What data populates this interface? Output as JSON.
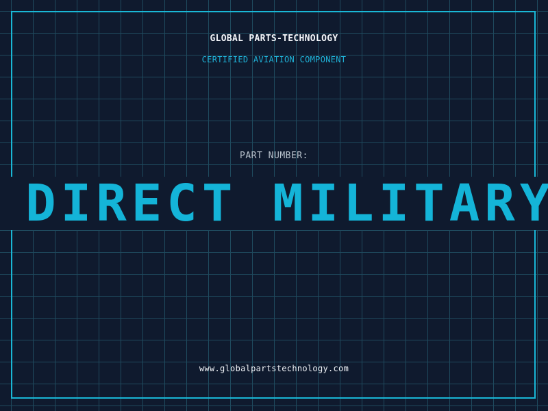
{
  "header": {
    "company_name": "GLOBAL PARTS-TECHNOLOGY",
    "tagline": "CERTIFIED AVIATION COMPONENT"
  },
  "part": {
    "label": "PART NUMBER:",
    "scrolling_text": "S DIRECT MILITARY D"
  },
  "footer": {
    "website": "www.globalpartstechnology.com"
  },
  "colors": {
    "background": "#0f1a2e",
    "grid_line": "#1f4a5e",
    "accent": "#19b7d6",
    "text_light": "#f4f6fa",
    "label_gray": "#b8c2cc"
  }
}
